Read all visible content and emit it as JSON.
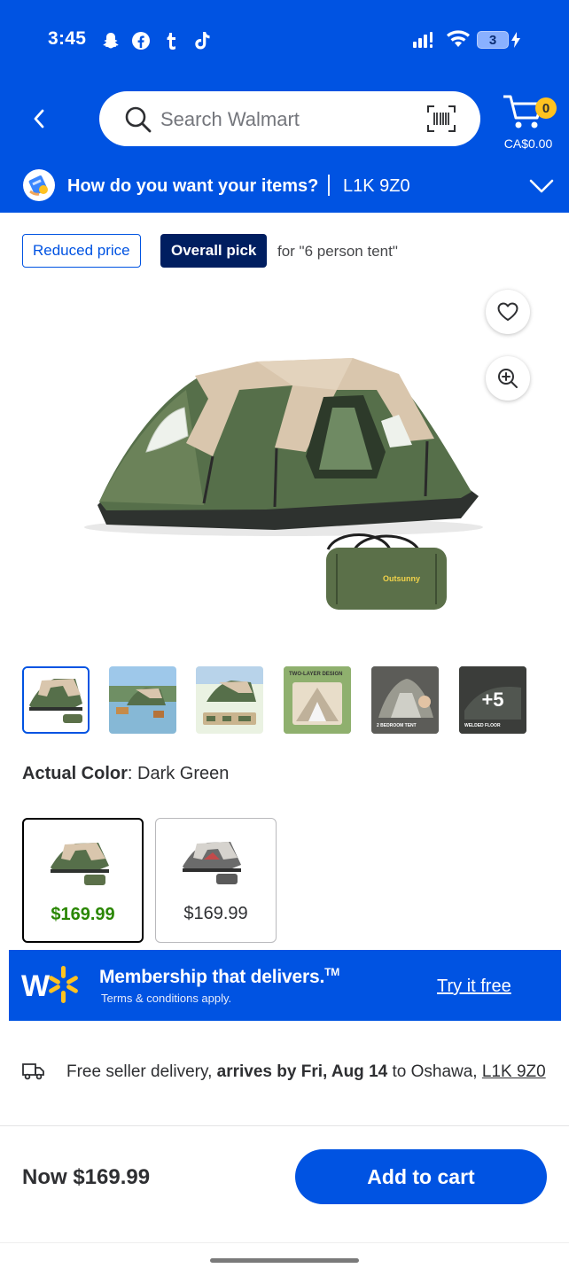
{
  "status_bar": {
    "time": "3:45",
    "apps": [
      "snapchat-icon",
      "facebook-icon",
      "tumblr-icon",
      "tiktok-icon"
    ],
    "battery": "3"
  },
  "header": {
    "search_placeholder": "Search Walmart",
    "cart_count": "0",
    "cart_total": "CA$0.00",
    "delivery_question": "How do you want your items?",
    "postal_code": "L1K 9Z0",
    "brand_color": "#0053e2"
  },
  "tags": {
    "reduced": "Reduced price",
    "overall_pick": "Overall pick",
    "for_query": "for \"6 person tent\""
  },
  "gallery": {
    "bag_brand": "Outsunny",
    "thumbnails": [
      {
        "name": "tent-main-thumb",
        "selected": true
      },
      {
        "name": "tent-lake-thumb",
        "selected": false
      },
      {
        "name": "tent-components-thumb",
        "selected": false
      },
      {
        "name": "tent-two-layer-thumb",
        "caption": "TWO-LAYER DESIGN",
        "selected": false
      },
      {
        "name": "tent-bedroom-thumb",
        "caption": "2 BEDROOM TENT",
        "selected": false
      },
      {
        "name": "tent-more-thumb",
        "caption": "WELDED FLOOR",
        "overlay": "+5",
        "selected": false
      }
    ]
  },
  "color": {
    "label": "Actual Color",
    "value": ": Dark Green",
    "options": [
      {
        "name": "Dark Green",
        "price": "$169.99",
        "selected": true
      },
      {
        "name": "Grey",
        "price": "$169.99",
        "selected": false
      }
    ]
  },
  "membership": {
    "title": "Membership that delivers.",
    "tm": "TM",
    "terms": "Terms & conditions apply.",
    "cta": "Try it free"
  },
  "delivery": {
    "prefix": "Free seller delivery, ",
    "arrives": "arrives by Fri, Aug 14",
    "middle": " to Oshawa, ",
    "postal": "L1K 9Z0"
  },
  "purchase": {
    "now_price": "Now $169.99",
    "add_to_cart": "Add to cart"
  }
}
